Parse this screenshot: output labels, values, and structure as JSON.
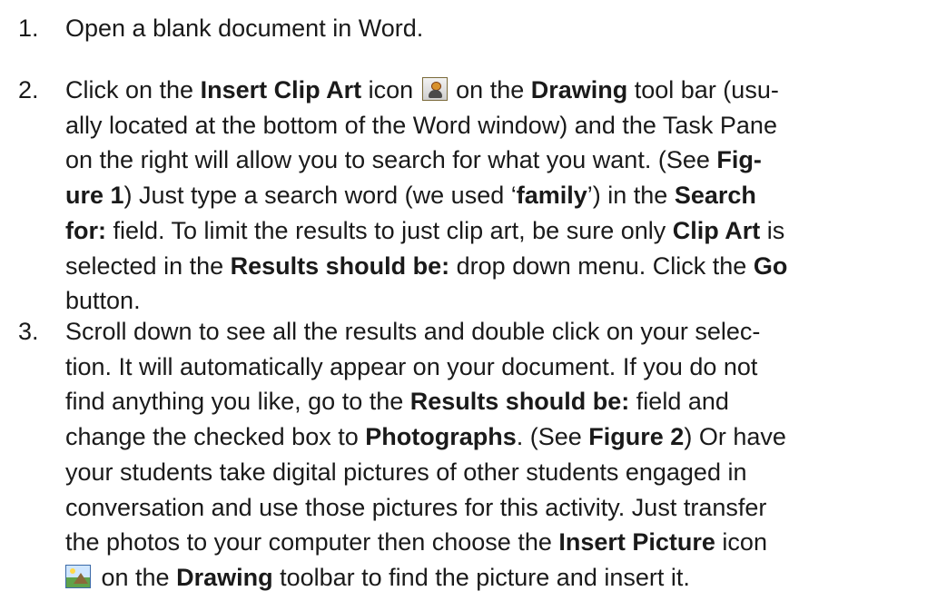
{
  "steps": [
    {
      "number": "1.",
      "lines": [
        [
          {
            "t": "Open a blank document in Word."
          }
        ]
      ]
    },
    {
      "number": "2.",
      "lines": [
        [
          {
            "t": "Click on the "
          },
          {
            "t": "Insert Clip Art",
            "b": true
          },
          {
            "t": " icon "
          },
          {
            "icon": "clipart-icon"
          },
          {
            "t": " on the "
          },
          {
            "t": "Drawing",
            "b": true
          },
          {
            "t": " tool bar (usu-"
          }
        ],
        [
          {
            "t": "ally located at the bottom of the Word window) and the Task Pane"
          }
        ],
        [
          {
            "t": "on the right will allow you to search for what you want. (See "
          },
          {
            "t": "Fig-",
            "b": true
          }
        ],
        [
          {
            "t": "ure 1",
            "b": true
          },
          {
            "t": ") Just type a search word (we used ‘"
          },
          {
            "t": "family",
            "b": true
          },
          {
            "t": "’) in the "
          },
          {
            "t": "Search",
            "b": true
          }
        ],
        [
          {
            "t": "for:",
            "b": true
          },
          {
            "t": " field. To limit the results to just clip art, be sure only "
          },
          {
            "t": "Clip Art",
            "b": true
          },
          {
            "t": " is"
          }
        ],
        [
          {
            "t": "selected in the "
          },
          {
            "t": "Results should be:",
            "b": true
          },
          {
            "t": " drop down menu. Click the "
          },
          {
            "t": "Go",
            "b": true
          }
        ],
        [
          {
            "t": "button."
          }
        ]
      ]
    },
    {
      "number": "3.",
      "lines": [
        [
          {
            "t": "Scroll down to see all the results and double click on your selec-"
          }
        ],
        [
          {
            "t": "tion. It will automatically appear on your document. If you do not"
          }
        ],
        [
          {
            "t": "find anything you like, go to the "
          },
          {
            "t": "Results should be:",
            "b": true
          },
          {
            "t": " field and"
          }
        ],
        [
          {
            "t": "change the checked box to "
          },
          {
            "t": "Photographs",
            "b": true
          },
          {
            "t": ". (See "
          },
          {
            "t": "Figure 2",
            "b": true
          },
          {
            "t": ") Or have"
          }
        ],
        [
          {
            "t": "your students take digital pictures of other students engaged in"
          }
        ],
        [
          {
            "t": "conversation and use those pictures for this activity. Just transfer"
          }
        ],
        [
          {
            "t": "the photos to your computer then choose the "
          },
          {
            "t": "Insert Picture",
            "b": true
          },
          {
            "t": " icon"
          }
        ],
        [
          {
            "icon": "picture-icon"
          },
          {
            "t": " on the "
          },
          {
            "t": "Drawing",
            "b": true
          },
          {
            "t": " toolbar to find the picture and insert it."
          }
        ]
      ]
    }
  ]
}
